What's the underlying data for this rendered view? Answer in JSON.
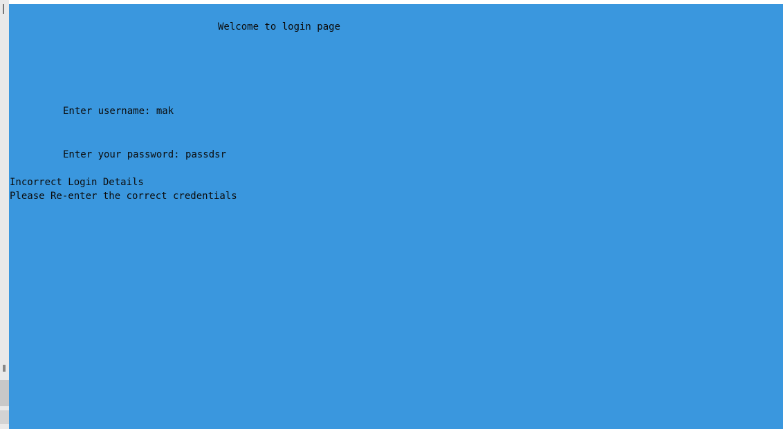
{
  "console": {
    "welcome": "Welcome to login page",
    "username_prompt": "Enter username: ",
    "username_value": "mak",
    "password_prompt": "Enter your password: ",
    "password_value": "passdsr",
    "error_title": "Incorrect Login Details",
    "error_message": "Please Re-enter the correct credentials"
  },
  "colors": {
    "background": "#3a97de",
    "text": "#0b0b0b"
  }
}
